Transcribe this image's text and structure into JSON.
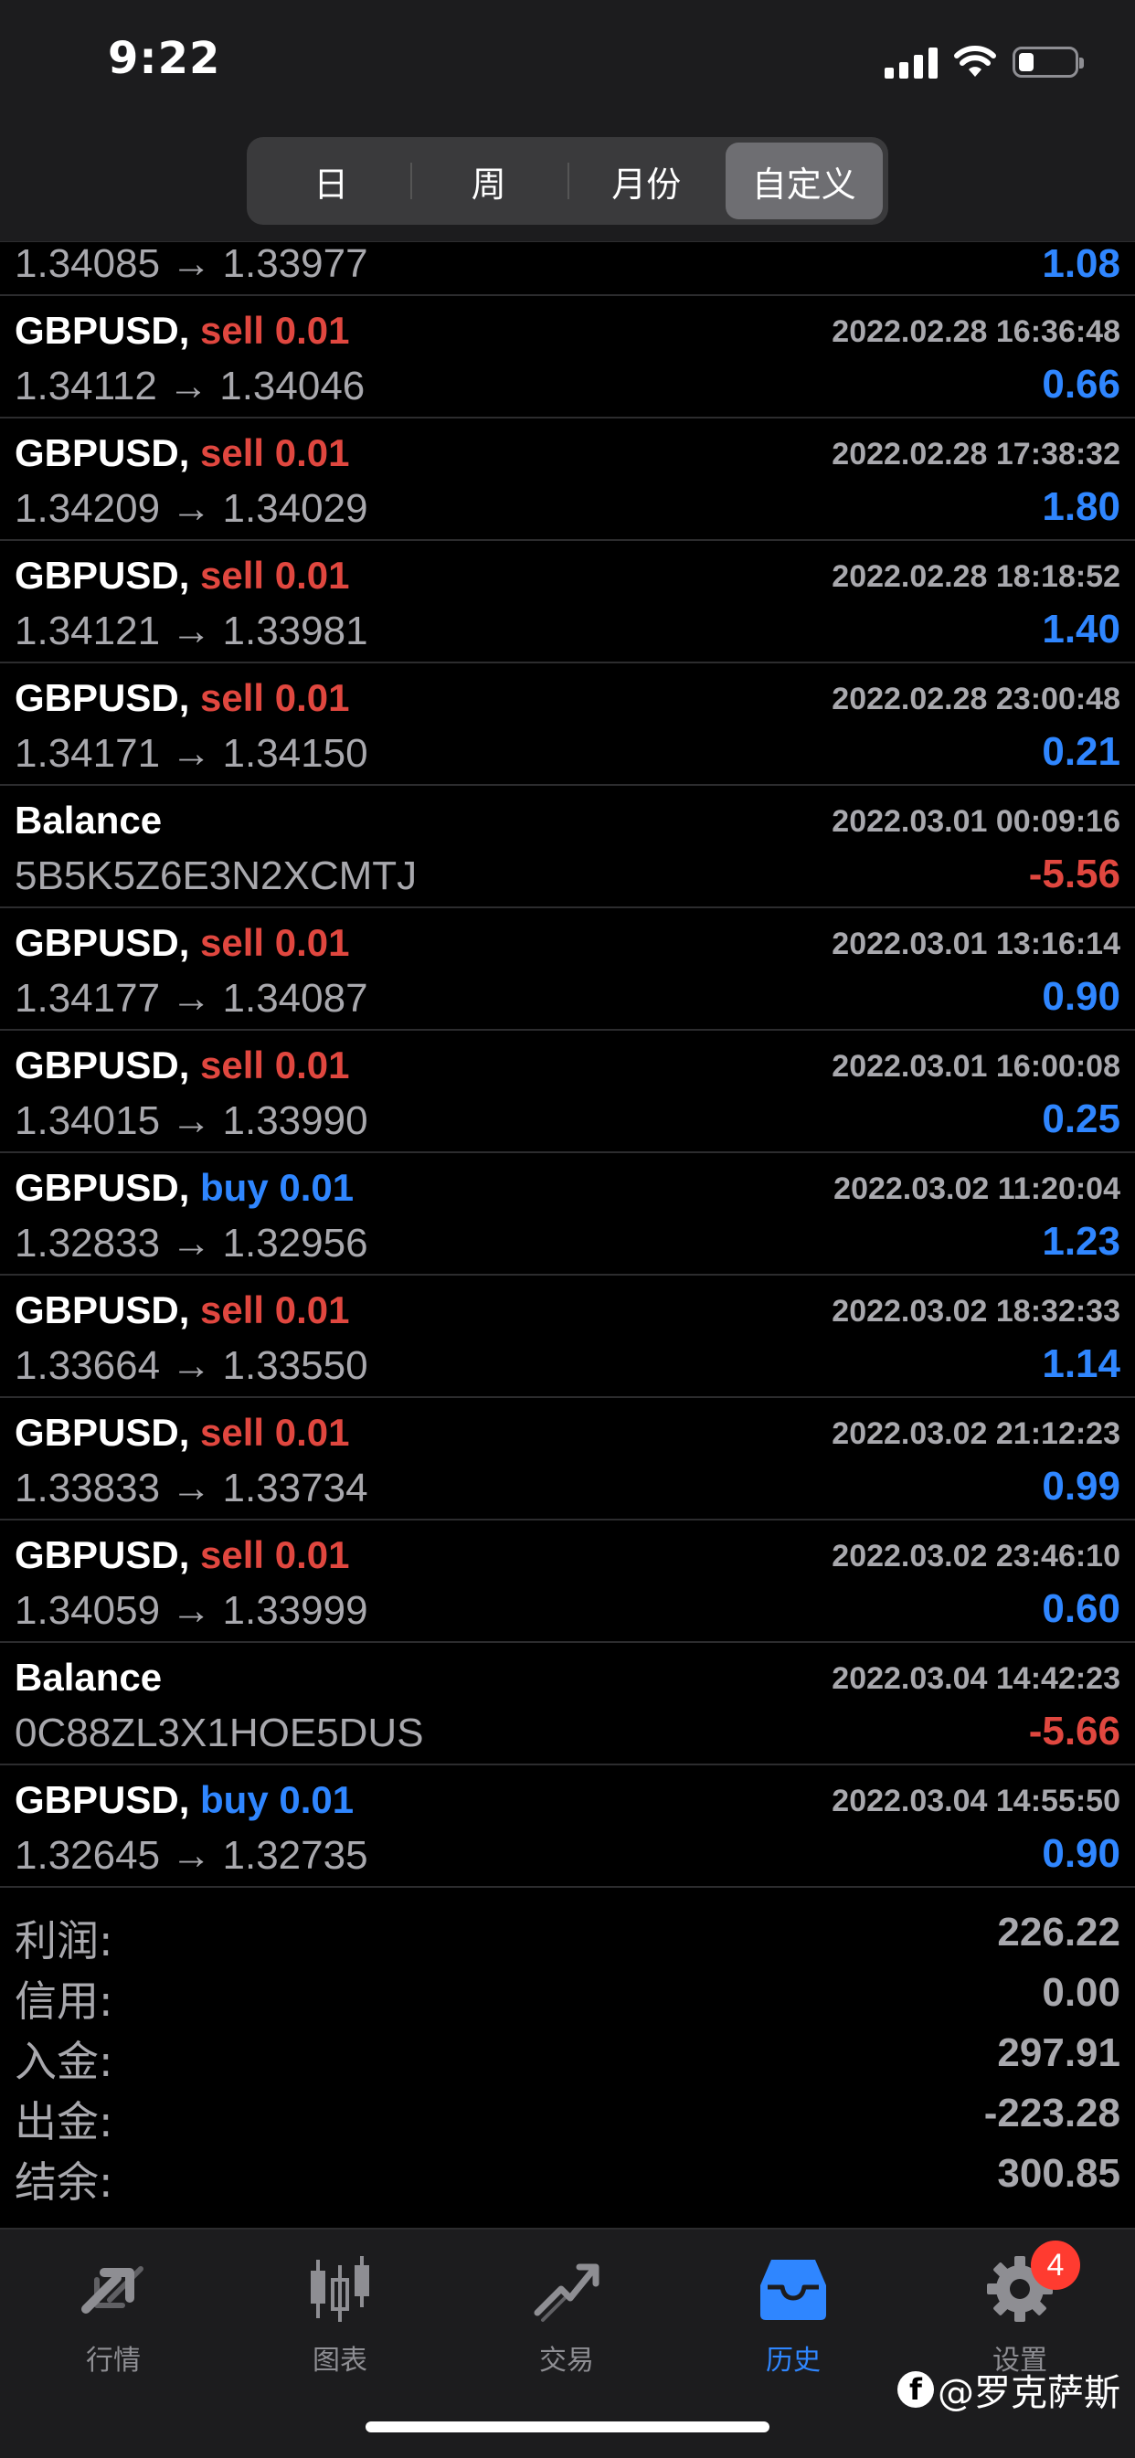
{
  "status": {
    "time": "9:22"
  },
  "filter_tabs": [
    {
      "label": "日",
      "active": false
    },
    {
      "label": "周",
      "active": false
    },
    {
      "label": "月份",
      "active": false
    },
    {
      "label": "自定义",
      "active": true
    }
  ],
  "partial_row": {
    "prices": "1.34085 → 1.33977",
    "profit": "1.08"
  },
  "rows": [
    {
      "symbol": "GBPUSD,",
      "side": "sell 0.01",
      "side_type": "sell",
      "time": "2022.02.28 16:36:48",
      "prices": "1.34112 → 1.34046",
      "profit": "0.66",
      "profit_sign": "pos"
    },
    {
      "symbol": "GBPUSD,",
      "side": "sell 0.01",
      "side_type": "sell",
      "time": "2022.02.28 17:38:32",
      "prices": "1.34209 → 1.34029",
      "profit": "1.80",
      "profit_sign": "pos"
    },
    {
      "symbol": "GBPUSD,",
      "side": "sell 0.01",
      "side_type": "sell",
      "time": "2022.02.28 18:18:52",
      "prices": "1.34121 → 1.33981",
      "profit": "1.40",
      "profit_sign": "pos"
    },
    {
      "symbol": "GBPUSD,",
      "side": "sell 0.01",
      "side_type": "sell",
      "time": "2022.02.28 23:00:48",
      "prices": "1.34171 → 1.34150",
      "profit": "0.21",
      "profit_sign": "pos"
    },
    {
      "symbol": "Balance",
      "side": "",
      "side_type": "",
      "time": "2022.03.01 00:09:16",
      "prices": "5B5K5Z6E3N2XCMTJ",
      "profit": "-5.56",
      "profit_sign": "neg"
    },
    {
      "symbol": "GBPUSD,",
      "side": "sell 0.01",
      "side_type": "sell",
      "time": "2022.03.01 13:16:14",
      "prices": "1.34177 → 1.34087",
      "profit": "0.90",
      "profit_sign": "pos"
    },
    {
      "symbol": "GBPUSD,",
      "side": "sell 0.01",
      "side_type": "sell",
      "time": "2022.03.01 16:00:08",
      "prices": "1.34015 → 1.33990",
      "profit": "0.25",
      "profit_sign": "pos"
    },
    {
      "symbol": "GBPUSD,",
      "side": "buy 0.01",
      "side_type": "buy",
      "time": "2022.03.02 11:20:04",
      "prices": "1.32833 → 1.32956",
      "profit": "1.23",
      "profit_sign": "pos"
    },
    {
      "symbol": "GBPUSD,",
      "side": "sell 0.01",
      "side_type": "sell",
      "time": "2022.03.02 18:32:33",
      "prices": "1.33664 → 1.33550",
      "profit": "1.14",
      "profit_sign": "pos"
    },
    {
      "symbol": "GBPUSD,",
      "side": "sell 0.01",
      "side_type": "sell",
      "time": "2022.03.02 21:12:23",
      "prices": "1.33833 → 1.33734",
      "profit": "0.99",
      "profit_sign": "pos"
    },
    {
      "symbol": "GBPUSD,",
      "side": "sell 0.01",
      "side_type": "sell",
      "time": "2022.03.02 23:46:10",
      "prices": "1.34059 → 1.33999",
      "profit": "0.60",
      "profit_sign": "pos"
    },
    {
      "symbol": "Balance",
      "side": "",
      "side_type": "",
      "time": "2022.03.04 14:42:23",
      "prices": "0C88ZL3X1HOE5DUS",
      "profit": "-5.66",
      "profit_sign": "neg"
    },
    {
      "symbol": "GBPUSD,",
      "side": "buy 0.01",
      "side_type": "buy",
      "time": "2022.03.04 14:55:50",
      "prices": "1.32645 → 1.32735",
      "profit": "0.90",
      "profit_sign": "pos"
    }
  ],
  "summary": [
    {
      "label": "利润:",
      "value": "226.22"
    },
    {
      "label": "信用:",
      "value": "0.00"
    },
    {
      "label": "入金:",
      "value": "297.91"
    },
    {
      "label": "出金:",
      "value": "-223.28"
    },
    {
      "label": "结余:",
      "value": "300.85"
    }
  ],
  "tabbar": [
    {
      "label": "行情",
      "icon": "quotes-icon",
      "active": false
    },
    {
      "label": "图表",
      "icon": "chart-icon",
      "active": false
    },
    {
      "label": "交易",
      "icon": "trade-icon",
      "active": false
    },
    {
      "label": "历史",
      "icon": "history-icon",
      "active": true
    },
    {
      "label": "设置",
      "icon": "settings-icon",
      "active": false,
      "badge": "4"
    }
  ],
  "watermark": {
    "icon": "f",
    "text": "@罗克萨斯"
  },
  "colors": {
    "sell": "#e0473f",
    "buy": "#2f86ff",
    "positive": "#2f86ff",
    "negative": "#e0473f",
    "accent": "#2f86ff"
  }
}
